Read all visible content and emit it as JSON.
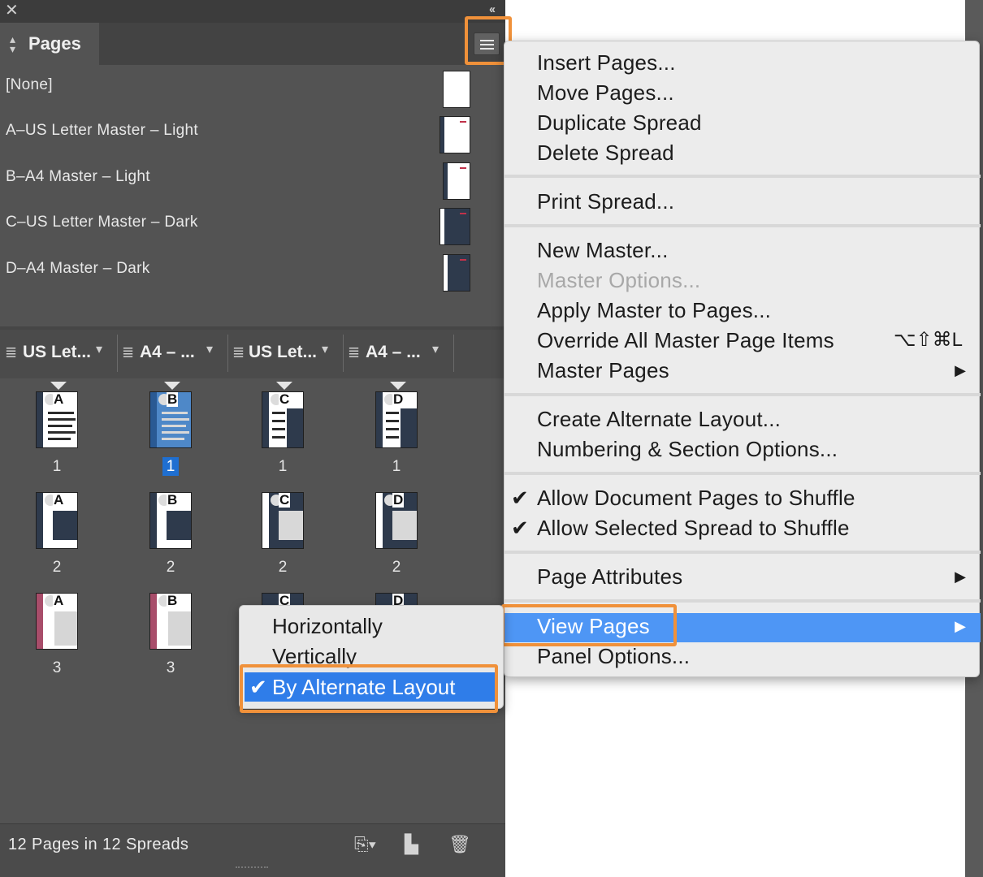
{
  "panel": {
    "tab_label": "Pages",
    "masters": [
      {
        "name": "[None]"
      },
      {
        "name": "A–US Letter Master – Light"
      },
      {
        "name": "B–A4 Master – Light"
      },
      {
        "name": "C–US Letter Master – Dark"
      },
      {
        "name": "D–A4 Master – Dark"
      }
    ],
    "layouts": [
      {
        "name": "US Let..."
      },
      {
        "name": "A4 – ..."
      },
      {
        "name": "US Let..."
      },
      {
        "name": "A4 – ..."
      }
    ],
    "pages": [
      {
        "letter": "A",
        "num": "1"
      },
      {
        "letter": "B",
        "num": "1"
      },
      {
        "letter": "C",
        "num": "1"
      },
      {
        "letter": "D",
        "num": "1"
      },
      {
        "letter": "A",
        "num": "2"
      },
      {
        "letter": "B",
        "num": "2"
      },
      {
        "letter": "C",
        "num": "2"
      },
      {
        "letter": "D",
        "num": "2"
      },
      {
        "letter": "A",
        "num": "3"
      },
      {
        "letter": "B",
        "num": "3"
      },
      {
        "letter": "C",
        "num": ""
      },
      {
        "letter": "D",
        "num": ""
      }
    ],
    "status": "12 Pages in 12 Spreads"
  },
  "menu": {
    "insert_pages": "Insert Pages...",
    "move_pages": "Move Pages...",
    "duplicate_spread": "Duplicate Spread",
    "delete_spread": "Delete Spread",
    "print_spread": "Print Spread...",
    "new_master": "New Master...",
    "master_options": "Master Options...",
    "apply_master": "Apply Master to Pages...",
    "override_all": "Override All Master Page Items",
    "override_shortcut": "⌥⇧⌘L",
    "master_pages": "Master Pages",
    "create_alt_layout": "Create Alternate Layout...",
    "numbering": "Numbering & Section Options...",
    "allow_doc_shuffle": "Allow Document Pages to Shuffle",
    "allow_spread_shuffle": "Allow Selected Spread to Shuffle",
    "page_attributes": "Page Attributes",
    "view_pages": "View Pages",
    "panel_options": "Panel Options..."
  },
  "submenu": {
    "horizontally": "Horizontally",
    "vertically": "Vertically",
    "by_alternate_layout": "By Alternate Layout"
  },
  "colors": {
    "highlight_outline": "#f0913a",
    "menu_active": "#4e96f5",
    "submenu_active": "#2f7de9"
  }
}
